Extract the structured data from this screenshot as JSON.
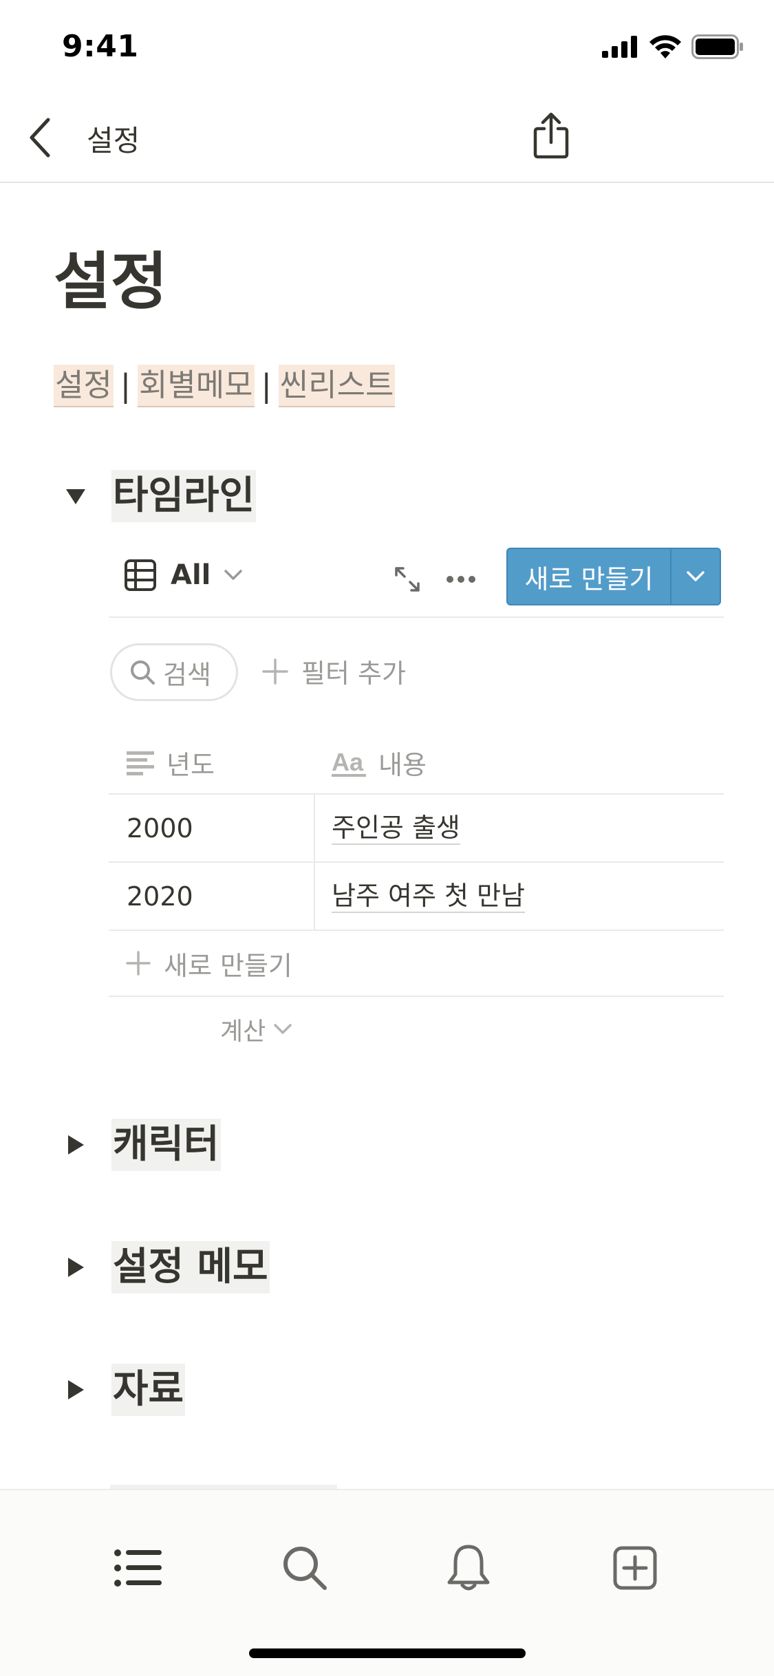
{
  "status_bar": {
    "time": "9:41"
  },
  "nav": {
    "title": "설정"
  },
  "page": {
    "title": "설정",
    "links": [
      "설정",
      "회별메모",
      "씬리스트"
    ],
    "separator": "|"
  },
  "sections": [
    {
      "title": "타임라인",
      "expanded": true
    },
    {
      "title": "캐릭터",
      "expanded": false
    },
    {
      "title": "설정 메모",
      "expanded": false
    },
    {
      "title": "자료",
      "expanded": false
    }
  ],
  "database": {
    "view_label": "All",
    "new_button_label": "새로 만들기",
    "search_label": "검색",
    "add_filter_label": "필터 추가",
    "columns": [
      {
        "label": "년도",
        "icon": "text-lines-icon"
      },
      {
        "label": "내용",
        "icon": "title-aa-icon"
      }
    ],
    "rows": [
      {
        "year": "2000",
        "content": "주인공 출생"
      },
      {
        "year": "2020",
        "content": "남주 여주 첫 만남"
      }
    ],
    "new_row_label": "새로 만들기",
    "calculate_label": "계산"
  },
  "colors": {
    "accent": "#529cca",
    "text": "#37352f",
    "muted": "#9b9a97",
    "link_highlight": "#f9e9dc",
    "block_bg": "#f1f1ef"
  }
}
